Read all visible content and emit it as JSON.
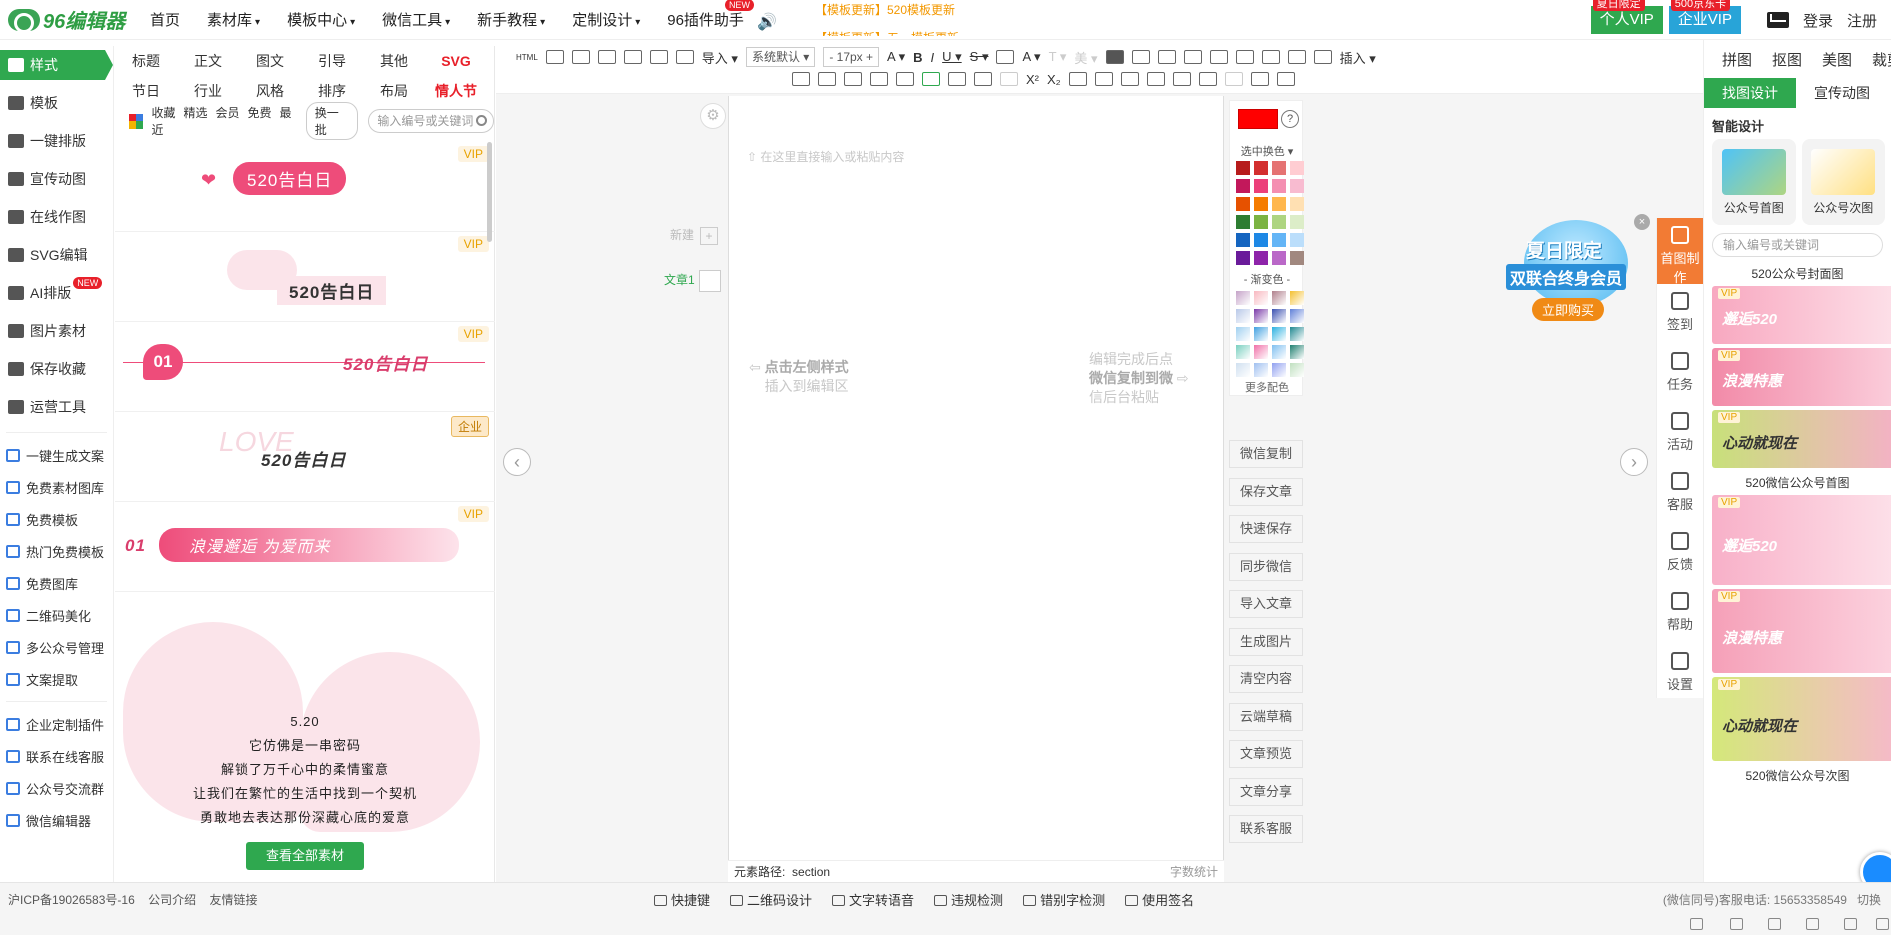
{
  "nav": {
    "logo_text": "96编辑器",
    "items": [
      {
        "label": "首页",
        "caret": ""
      },
      {
        "label": "素材库",
        "caret": "▾"
      },
      {
        "label": "模板中心",
        "caret": "▾"
      },
      {
        "label": "微信工具",
        "caret": "▾"
      },
      {
        "label": "新手教程",
        "caret": "▾"
      },
      {
        "label": "定制设计",
        "caret": "▾"
      },
      {
        "label": "96插件助手",
        "caret": ""
      }
    ],
    "plugin_badge": "NEW",
    "notice_line1": "【模板更新】520模板更新",
    "notice_line2": "【模板更新】五一模板更新",
    "vip_personal": "个人VIP",
    "vip_personal_tag": "夏日限定",
    "vip_company": "企业VIP",
    "vip_company_tag": "500京东卡",
    "login": "登录",
    "register": "注册"
  },
  "left_sidebar": {
    "main": [
      {
        "label": "样式",
        "icon": "grid-icon"
      },
      {
        "label": "模板",
        "icon": "layers-icon"
      },
      {
        "label": "一键排版",
        "icon": "layout-icon"
      },
      {
        "label": "宣传动图",
        "icon": "gif-icon"
      },
      {
        "label": "在线作图",
        "icon": "edit-image-icon"
      },
      {
        "label": "SVG编辑",
        "icon": "svg-icon"
      },
      {
        "label": "AI排版",
        "icon": "ai-icon"
      },
      {
        "label": "图片素材",
        "icon": "image-icon"
      },
      {
        "label": "保存收藏",
        "icon": "heart-icon"
      },
      {
        "label": "运营工具",
        "icon": "apps-icon"
      }
    ],
    "ai_badge": "NEW",
    "sub": [
      {
        "label": "一键生成文案"
      },
      {
        "label": "免费素材图库"
      },
      {
        "label": "免费模板"
      },
      {
        "label": "热门免费模板"
      },
      {
        "label": "免费图库"
      },
      {
        "label": "二维码美化"
      },
      {
        "label": "多公众号管理"
      },
      {
        "label": "文案提取"
      }
    ],
    "sub2": [
      {
        "label": "企业定制插件"
      },
      {
        "label": "联系在线客服"
      },
      {
        "label": "公众号交流群"
      },
      {
        "label": "微信编辑器"
      }
    ]
  },
  "style_panel": {
    "cat_row1": [
      "标题",
      "正文",
      "图文",
      "引导",
      "其他",
      "SVG"
    ],
    "cat_row2": [
      "节日",
      "行业",
      "风格",
      "排序",
      "布局",
      "情人节"
    ],
    "filters": [
      "收藏",
      "精选",
      "会员",
      "免费",
      "最近"
    ],
    "swap": "换一批",
    "search_placeholder": "输入编号或关键词",
    "items": [
      {
        "tag": "VIP",
        "text": "520告白日"
      },
      {
        "tag": "VIP",
        "text": "520告白日"
      },
      {
        "tag": "VIP",
        "text": "520告白日",
        "num": "01"
      },
      {
        "tag": "企业",
        "text": "520告白日",
        "faded": "LOVE"
      },
      {
        "tag": "VIP",
        "text": "浪漫邂逅 为爱而来",
        "num": "01"
      }
    ],
    "poem": [
      "5.20",
      "它仿佛是一串密码",
      "解锁了万千心中的柔情蜜意",
      "让我们在繁忙的生活中找到一个契机",
      "勇敢地去表达那份深藏心底的爱意"
    ],
    "view_all": "查看全部素材"
  },
  "toolbar": {
    "html": "HTML",
    "import": "导入",
    "font_family": "系统默认",
    "font_size": "17px",
    "insert": "插入"
  },
  "editor": {
    "placeholder": "在这里直接输入或粘贴内容",
    "new_label": "新建",
    "doc_name": "文章1",
    "hint_left_1": "点击左侧样式",
    "hint_left_2": "插入到编辑区",
    "hint_right_1": "编辑完成后点",
    "hint_right_2": "微信复制到微",
    "hint_right_3": "信后台粘贴",
    "path_label": "元素路径:",
    "path_value": "section",
    "word_count": "字数统计"
  },
  "color_panel": {
    "selected_color": "#ff0000",
    "help": "?",
    "label_swap": "选中换色",
    "label_gradient": "- 渐变色 -",
    "more": "更多配色",
    "solid": [
      "#b71c1c",
      "#d32f2f",
      "#e57373",
      "#ffcdd2",
      "#c2185b",
      "#ec407a",
      "#f48fb1",
      "#f8bbd0",
      "#e65100",
      "#f57c00",
      "#ffb74d",
      "#ffe0b2",
      "#2e7d32",
      "#7cb342",
      "#aed581",
      "#dcedc8",
      "#1565c0",
      "#1e88e5",
      "#64b5f6",
      "#bbdefb",
      "#6a1b9a",
      "#8e24aa",
      "#ba68c8",
      "#a1887f"
    ],
    "gradient": [
      "#c5a3c8",
      "#f8b8c0",
      "#b0808c",
      "#f4c030",
      "#b8c8e8",
      "#7a3aa8",
      "#3a50b0",
      "#6080d8",
      "#a0d0f0",
      "#40a0e0",
      "#2ab0e0",
      "#208890",
      "#7ad0c0",
      "#f070a8",
      "#80c0f0",
      "#208070",
      "#d0e0f0",
      "#a0c0f0",
      "#90a0f0",
      "#c0e0c0"
    ]
  },
  "actions": [
    "微信复制",
    "保存文章",
    "快速保存",
    "同步微信",
    "导入文章",
    "生成图片",
    "清空内容",
    "云端草稿",
    "文章预览",
    "文章分享",
    "联系客服"
  ],
  "promo": {
    "line1": "夏日限定",
    "line2": "双联合终身会员",
    "line3": "立即购买",
    "close": "×"
  },
  "right_tools": [
    {
      "label": "首图制作"
    },
    {
      "label": "签到"
    },
    {
      "label": "任务"
    },
    {
      "label": "活动"
    },
    {
      "label": "客服"
    },
    {
      "label": "反馈"
    },
    {
      "label": "帮助"
    },
    {
      "label": "设置"
    }
  ],
  "right_panel": {
    "tabs": [
      "拼图",
      "抠图",
      "美图",
      "裁剪"
    ],
    "subtabs": [
      "找图设计",
      "宣传动图"
    ],
    "heading": "智能设计",
    "cards": [
      {
        "label": "公众号首图"
      },
      {
        "label": "公众号次图"
      }
    ],
    "search_placeholder": "输入编号或关键词",
    "sec1": "520公众号封面图",
    "sec2": "520微信公众号首图",
    "sec3": "520微信公众号次图",
    "vip": "VIP",
    "banners": [
      "邂逅520",
      "浪漫特惠",
      "心动就现在",
      "邂逅520",
      "浪漫特惠",
      "心动就现在"
    ]
  },
  "footer": {
    "icp": "沪ICP备19026583号-16",
    "company": "公司介绍",
    "links": "友情链接",
    "tools": [
      "快捷键",
      "二维码设计",
      "文字转语音",
      "违规检测",
      "错别字检测",
      "使用签名"
    ],
    "contact": "(微信同号)客服电话: 15653358549",
    "switch": "切换"
  }
}
